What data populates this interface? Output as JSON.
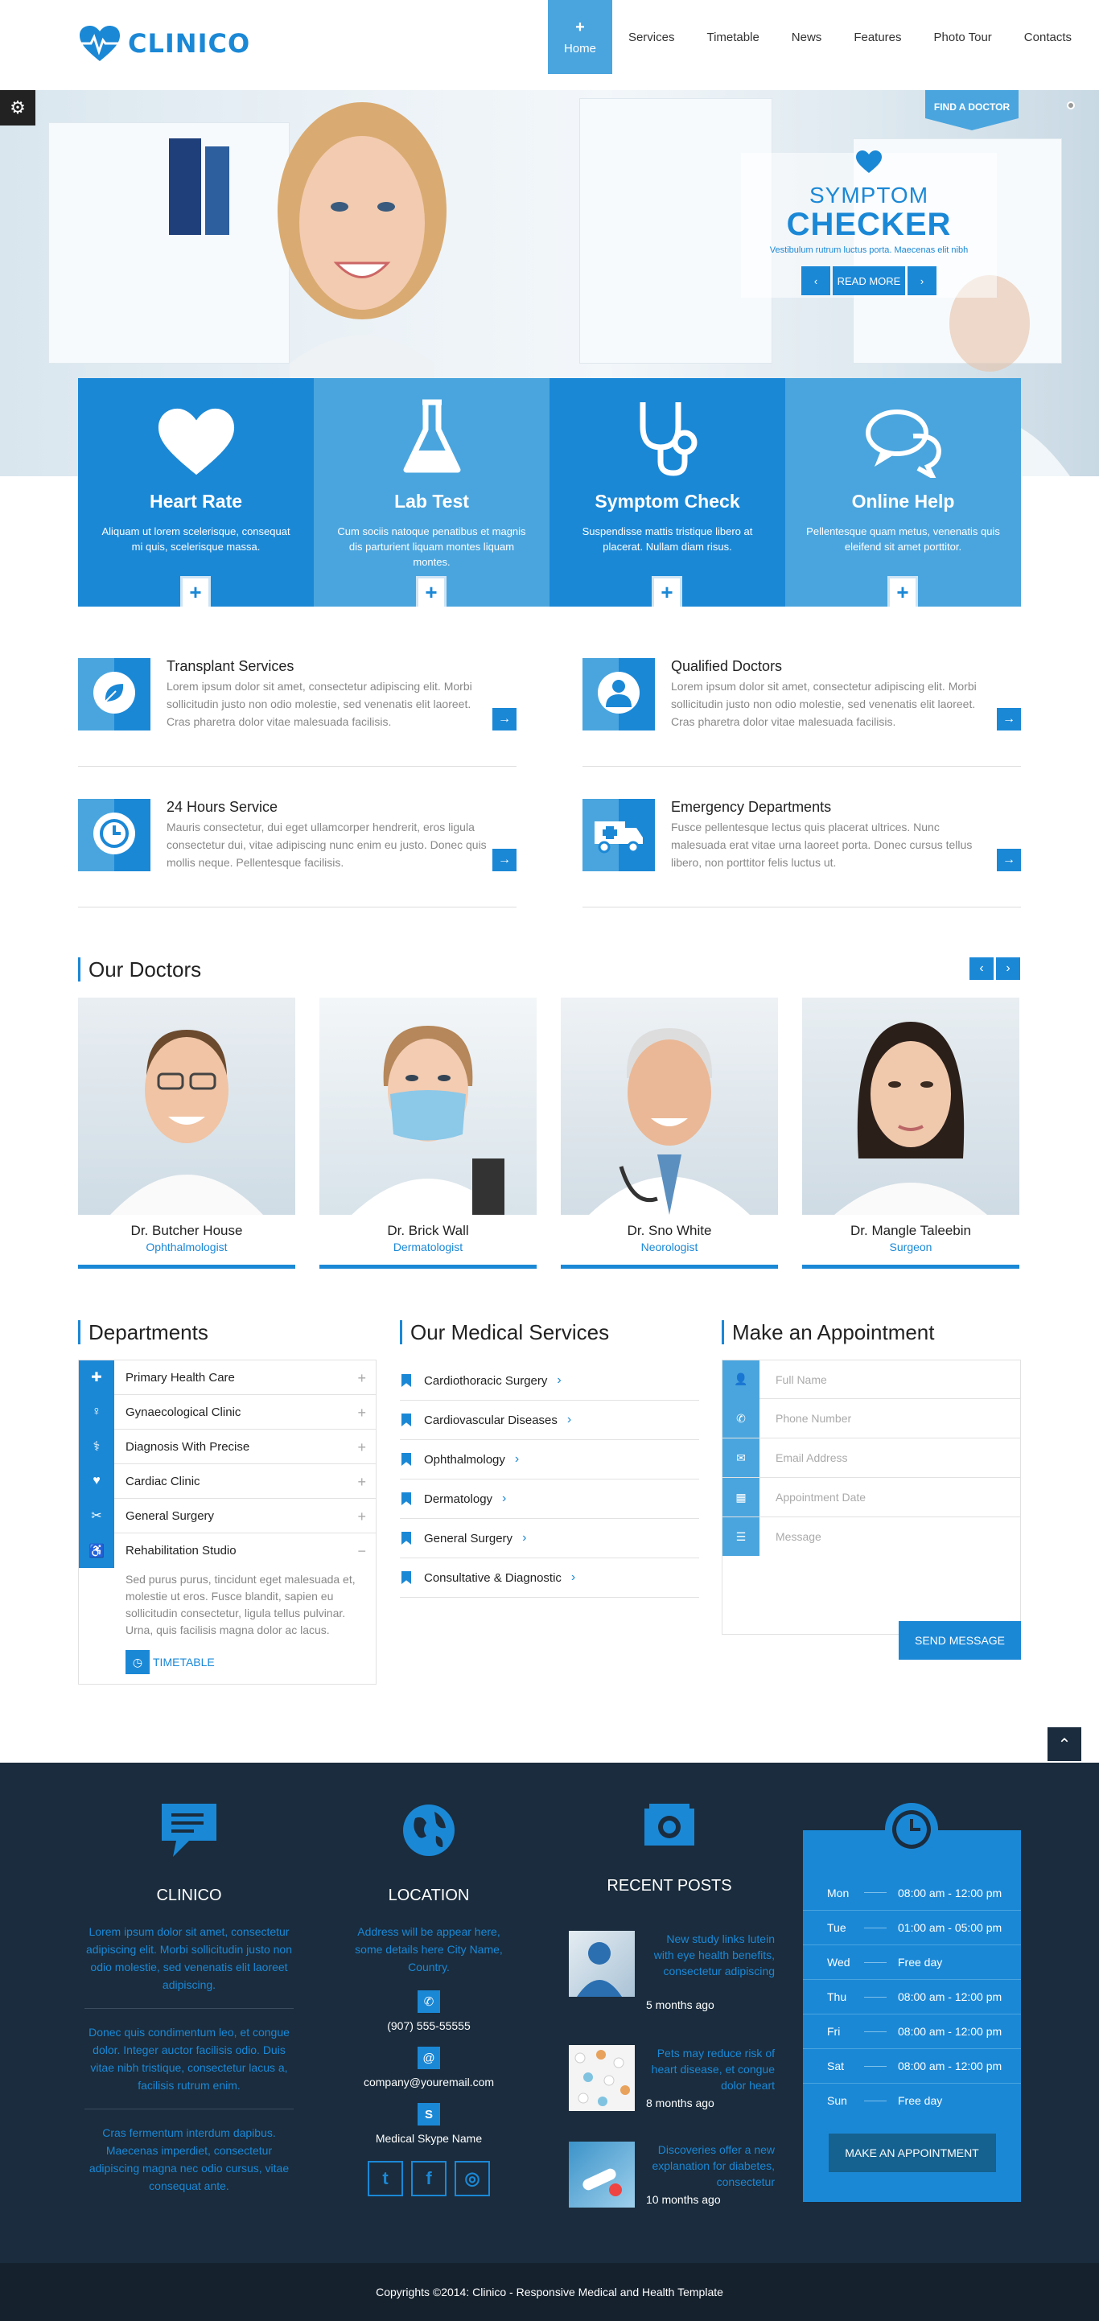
{
  "brand": {
    "name": "CLINICO",
    "accent": "#1b88d6",
    "light": "#4aa5de",
    "dark": "#1a2c3d"
  },
  "nav": [
    {
      "label": "Home",
      "active": true
    },
    {
      "label": "Services"
    },
    {
      "label": "Timetable"
    },
    {
      "label": "News"
    },
    {
      "label": "Features"
    },
    {
      "label": "Photo Tour"
    },
    {
      "label": "Contacts"
    }
  ],
  "hero": {
    "symptom_line1": "SYMPTOM",
    "symptom_line2": "CHECKER",
    "symptom_text": "Vestibulum rutrum luctus porta. Maecenas elit nibh",
    "read_more": "READ MORE",
    "prev": "‹",
    "next": "›",
    "find_doctor": "FIND A DOCTOR"
  },
  "features": [
    {
      "title": "Heart Rate",
      "text": "Aliquam ut lorem scelerisque, consequat mi quis, scelerisque massa.",
      "icon": "heart-icon"
    },
    {
      "title": "Lab Test",
      "text": "Cum sociis natoque penatibus et magnis dis parturient liquam montes liquam montes.",
      "icon": "flask-icon"
    },
    {
      "title": "Symptom Check",
      "text": "Suspendisse mattis tristique libero at placerat. Nullam diam risus.",
      "icon": "stethoscope-icon"
    },
    {
      "title": "Online Help",
      "text": "Pellentesque quam metus, venenatis quis eleifend sit amet porttitor.",
      "icon": "chat-icon"
    }
  ],
  "services": [
    {
      "title": "Transplant Services",
      "text": "Lorem ipsum dolor sit amet, consectetur adipiscing elit. Morbi sollicitudin justo non odio molestie, sed venenatis elit laoreet. Cras pharetra dolor vitae malesuada facilisis.",
      "icon": "leaf-icon"
    },
    {
      "title": "Qualified Doctors",
      "text": "Lorem ipsum dolor sit amet, consectetur adipiscing elit. Morbi sollicitudin justo non odio molestie, sed venenatis elit laoreet. Cras pharetra dolor vitae malesuada facilisis.",
      "icon": "doctor-icon"
    },
    {
      "title": "24 Hours Service",
      "text": "Mauris consectetur, dui eget ullamcorper hendrerit, eros ligula consectetur dui, vitae adipiscing nunc enim eu justo. Donec quis mollis neque. Pellentesque facilisis.",
      "icon": "clock-icon"
    },
    {
      "title": "Emergency Departments",
      "text": "Fusce pellentesque lectus quis placerat ultrices. Nunc malesuada erat vitae urna laoreet porta. Donec cursus tellus libero, non porttitor felis luctus ut.",
      "icon": "ambulance-icon"
    }
  ],
  "doctors_title": "Our Doctors",
  "doctors": [
    {
      "name": "Dr. Butcher House",
      "role": "Ophthalmologist"
    },
    {
      "name": "Dr. Brick Wall",
      "role": "Dermatologist"
    },
    {
      "name": "Dr. Sno White",
      "role": "Neorologist"
    },
    {
      "name": "Dr. Mangle Taleebin",
      "role": "Surgeon"
    }
  ],
  "departments": {
    "title": "Departments",
    "items": [
      "Primary Health Care",
      "Gynaecological Clinic",
      "Diagnosis With Precise",
      "Cardiac Clinic",
      "General Surgery",
      "Rehabilitation Studio"
    ],
    "open_text": "Sed purus purus, tincidunt eget malesuada et, molestie ut eros. Fusce blandit, sapien eu sollicitudin consectetur, ligula tellus pulvinar. Urna, quis facilisis magna dolor ac lacus.",
    "timetable": "TIMETABLE"
  },
  "medical_services": {
    "title": "Our Medical Services",
    "items": [
      "Cardiothoracic Surgery",
      "Cardiovascular Diseases",
      "Ophthalmology",
      "Dermatology",
      "General Surgery",
      "Consultative & Diagnostic"
    ]
  },
  "appointment": {
    "title": "Make an Appointment",
    "fields": [
      "Full Name",
      "Phone Number",
      "Email Address",
      "Appointment Date",
      "Message"
    ],
    "send": "SEND MESSAGE"
  },
  "footer": {
    "clinico": {
      "title": "CLINICO",
      "p1": "Lorem ipsum dolor sit amet, consectetur adipiscing elit. Morbi sollicitudin justo non odio molestie, sed venenatis elit laoreet adipiscing.",
      "p2": "Donec quis condimentum leo, et congue dolor. Integer auctor facilisis odio. Duis vitae nibh tristique, consectetur lacus a, facilisis rutrum enim.",
      "p3": "Cras fermentum interdum dapibus. Maecenas imperdiet, consectetur adipiscing magna nec odio cursus, vitae consequat ante."
    },
    "location": {
      "title": "LOCATION",
      "address": "Address will be appear here, some details here City Name, Country.",
      "phone": "(907) 555-55555",
      "email": "company@youremail.com",
      "skype": "Medical Skype Name"
    },
    "posts": {
      "title": "RECENT POSTS",
      "items": [
        {
          "title": "New study links lutein with eye health benefits, consectetur adipiscing",
          "ago": "5 months ago"
        },
        {
          "title": "Pets may reduce risk of heart disease, et congue dolor heart",
          "ago": "8 months ago"
        },
        {
          "title": "Discoveries offer a new explanation for diabetes, consectetur",
          "ago": "10 months ago"
        }
      ]
    },
    "hours": [
      {
        "day": "Mon",
        "time": "08:00 am - 12:00 pm"
      },
      {
        "day": "Tue",
        "time": "01:00 am - 05:00 pm"
      },
      {
        "day": "Wed",
        "time": "Free day"
      },
      {
        "day": "Thu",
        "time": "08:00 am - 12:00 pm"
      },
      {
        "day": "Fri",
        "time": "08:00 am - 12:00 pm"
      },
      {
        "day": "Sat",
        "time": "08:00 am - 12:00 pm"
      },
      {
        "day": "Sun",
        "time": "Free day"
      }
    ],
    "hours_btn": "MAKE AN APPOINTMENT"
  },
  "copyright": "Copyrights ©2014: Clinico - Responsive Medical and Health Template"
}
